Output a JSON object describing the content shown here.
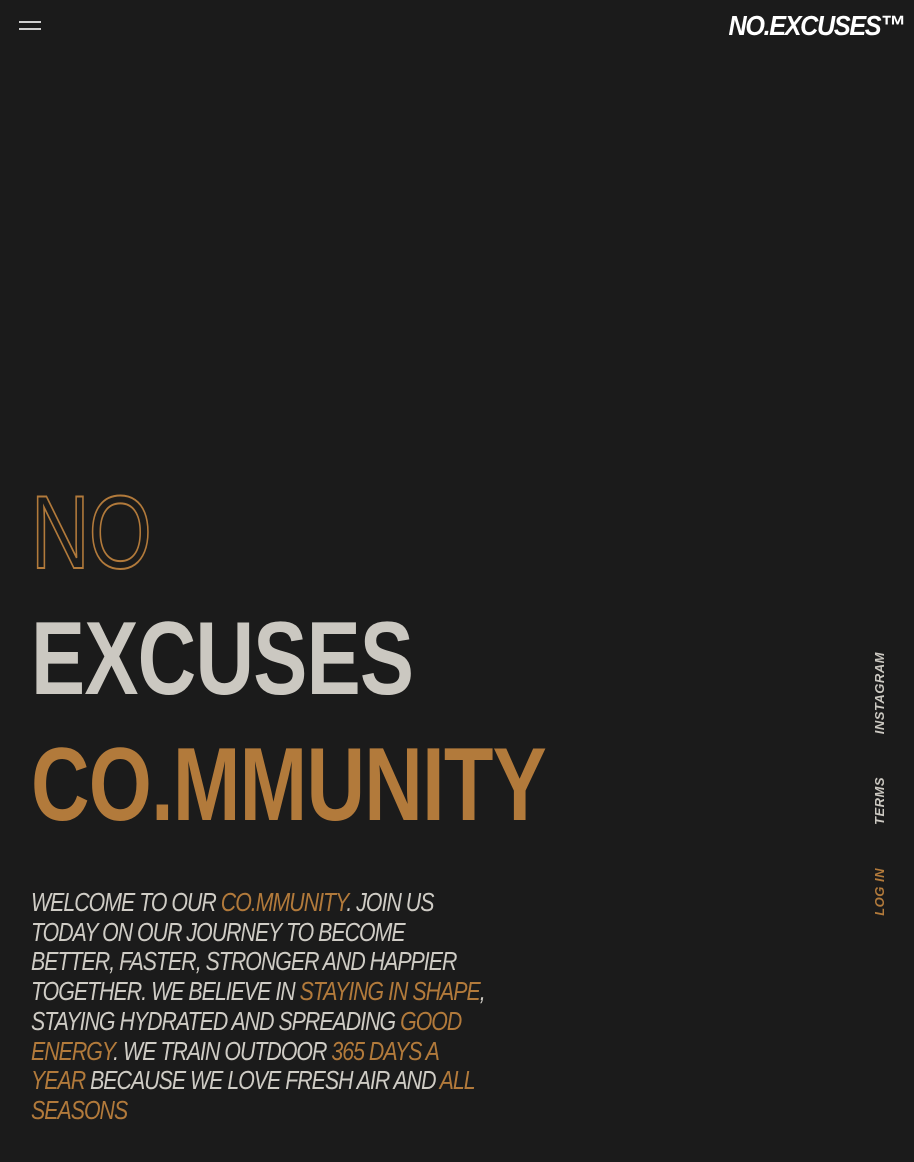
{
  "header": {
    "logo_text": "NO.EXCUSES™",
    "menu_icon": "hamburger-menu-icon"
  },
  "hero": {
    "line1": "NO",
    "line2": "EXCUSES",
    "line3": "CO.MMUNITY"
  },
  "intro": {
    "t1": "Welcome to our ",
    "h1": "Co.mmunity",
    "t2": ". Join us today on our journey to become better, faster, stronger and happier together. We believe in ",
    "h2": "staying in shape",
    "t3": ", staying hydrated and spreading ",
    "h3": "good energy",
    "t4": ". We train outdoor ",
    "h4": "365 days a year",
    "t5": " because we love fresh air and ",
    "h5": "all seasons"
  },
  "side_nav": {
    "instagram": "INSTAGRAM",
    "terms": "TERMS",
    "login": "LOG IN"
  },
  "colors": {
    "background": "#1b1b1b",
    "accent": "#b27a3b",
    "text": "#cbc8c1"
  }
}
